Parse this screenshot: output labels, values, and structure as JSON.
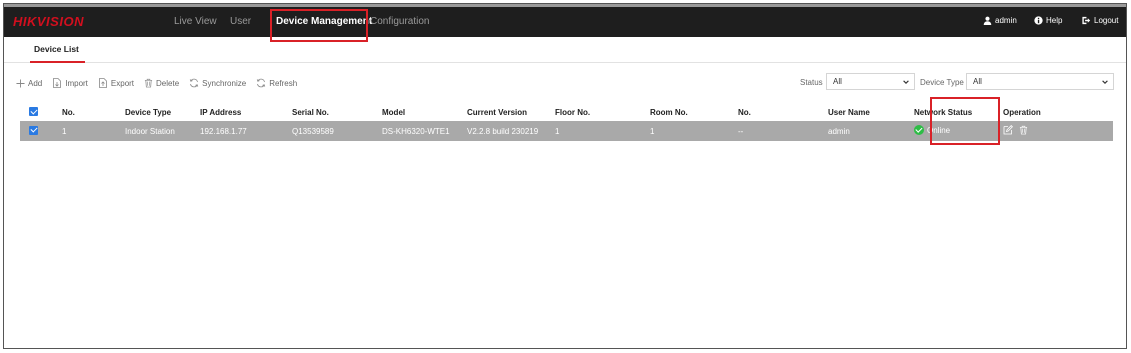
{
  "header": {
    "logo": "HIKVISION",
    "nav": [
      "Live View",
      "User",
      "Device Management",
      "Configuration"
    ],
    "active_nav": "Device Management",
    "user": "admin",
    "help": "Help",
    "logout": "Logout"
  },
  "subtabs": {
    "device_list": "Device List"
  },
  "toolbar": {
    "add": "Add",
    "import": "Import",
    "export": "Export",
    "delete": "Delete",
    "synchronize": "Synchronize",
    "refresh": "Refresh"
  },
  "filters": {
    "status_label": "Status",
    "status_value": "All",
    "device_type_label": "Device Type",
    "device_type_value": "All"
  },
  "table": {
    "columns": [
      "No.",
      "Device Type",
      "IP Address",
      "Serial No.",
      "Model",
      "Current Version",
      "Floor No.",
      "Room No.",
      "No.",
      "User Name",
      "Network Status",
      "Operation"
    ],
    "rows": [
      {
        "no": "1",
        "device_type": "Indoor Station",
        "ip": "192.168.1.77",
        "serial": "Q13539589",
        "model": "DS-KH6320-WTE1",
        "version": "V2.2.8 build 230219",
        "floor": "1",
        "room": "1",
        "sub_no": "--",
        "user": "admin",
        "status": "Online"
      }
    ]
  },
  "colors": {
    "accent_red": "#d92127",
    "topbar": "#1e1e1e",
    "selected_row": "#a9a9a9",
    "online_green": "#2ebd46",
    "checkbox_blue": "#2a7ae2"
  }
}
